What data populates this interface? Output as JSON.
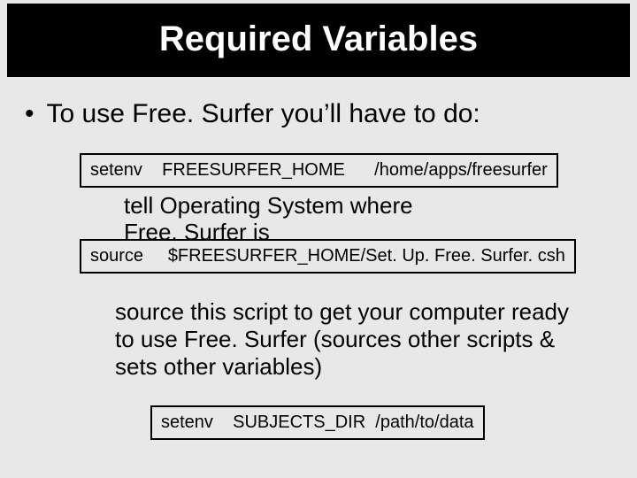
{
  "title": "Required Variables",
  "bullet": "To use Free. Surfer you’ll have to do:",
  "cmd1": "setenv    FREESURFER_HOME      /home/apps/freesurfer",
  "note1_l1": "tell Operating System where",
  "note1_l2": "Free. Surfer is",
  "cmd2": "source     $FREESURFER_HOME/Set. Up. Free. Surfer. csh",
  "note2": "source this script to get your computer ready to use Free. Surfer (sources other scripts & sets other variables)",
  "cmd3": "setenv    SUBJECTS_DIR  /path/to/data"
}
